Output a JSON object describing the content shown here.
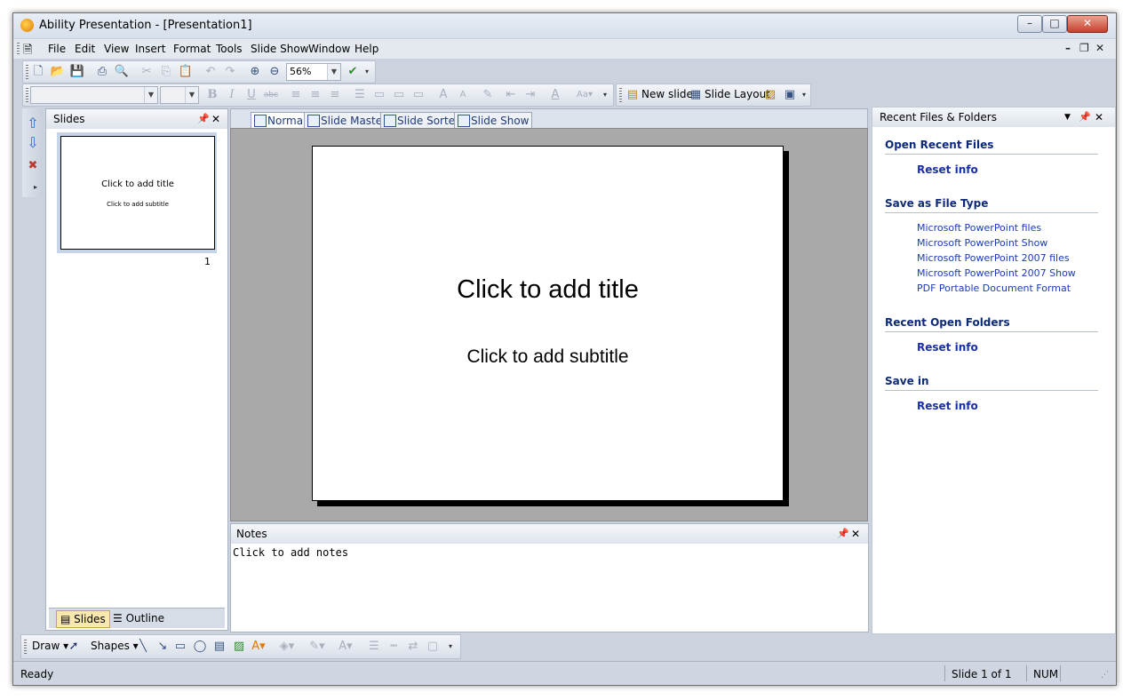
{
  "window": {
    "title": "Ability Presentation - [Presentation1]"
  },
  "menu": [
    "File",
    "Edit",
    "View",
    "Insert",
    "Format",
    "Tools",
    "Slide Show",
    "Window",
    "Help"
  ],
  "toolbar": {
    "zoom": "56%",
    "new_slide": "New slide",
    "slide_layout": "Slide Layout"
  },
  "slides_panel": {
    "title": "Slides",
    "slide_number": "1",
    "thumb_title": "Click to add title",
    "thumb_subtitle": "Click to add subtitle",
    "tab_slides": "Slides",
    "tab_outline": "Outline"
  },
  "view_tabs": [
    "Normal",
    "Slide Master",
    "Slide Sorter",
    "Slide Show"
  ],
  "slide": {
    "title": "Click to add title",
    "subtitle": "Click to add subtitle"
  },
  "notes": {
    "title": "Notes",
    "placeholder": "Click to add notes"
  },
  "right_panel": {
    "title": "Recent Files & Folders",
    "open_recent": "Open Recent Files",
    "reset": "Reset info",
    "save_as_type": "Save as File Type",
    "file_types": [
      "Microsoft PowerPoint files",
      "Microsoft PowerPoint Show",
      "Microsoft PowerPoint 2007 files",
      "Microsoft PowerPoint 2007 Show",
      "PDF Portable Document Format"
    ],
    "recent_folders": "Recent Open Folders",
    "save_in": "Save in"
  },
  "drawbar": {
    "draw": "Draw",
    "shapes": "Shapes"
  },
  "status": {
    "ready": "Ready",
    "slide": "Slide 1 of 1",
    "num": "NUM"
  },
  "colors": {
    "accent": "#0d2a7a",
    "link": "#1a3bb7",
    "active_tab": "#f8e8ae"
  }
}
